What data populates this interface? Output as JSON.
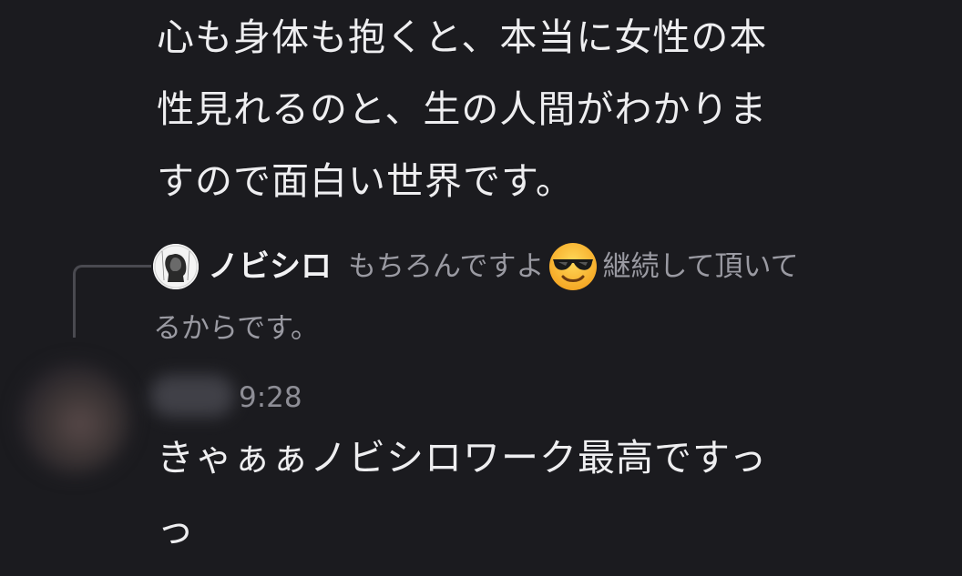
{
  "previous_message": {
    "lines": [
      "心も身体も抱くと、本当に女性の本",
      "性見れるのと、生の人間がわかりま",
      "すので面白い世界です。"
    ]
  },
  "reply": {
    "author": "ノビシロ",
    "text_part1": "もちろんですよ",
    "emoji": "sunglasses-emoji",
    "text_part2": "継続して頂いて",
    "text_line2": "るからです。"
  },
  "message": {
    "timestamp": "9:28",
    "lines": [
      "きゃぁぁノビシロワーク最高ですっ",
      "っ"
    ]
  },
  "colors": {
    "background": "#1b1b1f",
    "text": "#eeeef0",
    "muted": "#9a9aa2"
  }
}
